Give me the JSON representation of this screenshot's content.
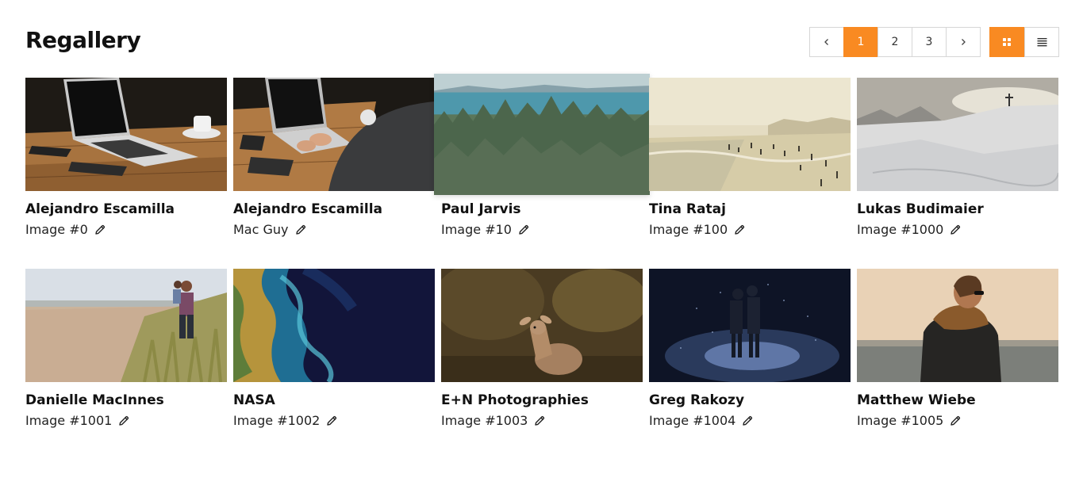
{
  "header": {
    "title": "Regallery"
  },
  "pagination": {
    "prev_icon": "chevron-left-icon",
    "next_icon": "chevron-right-icon",
    "pages": [
      "1",
      "2",
      "3"
    ],
    "current_page": "1"
  },
  "view_toggle": {
    "active": "grid",
    "grid_icon": "grid-icon",
    "list_icon": "list-icon"
  },
  "colors": {
    "accent": "#f98a22",
    "border": "#d6d6d6",
    "text": "#111111"
  },
  "gallery": {
    "items": [
      {
        "author": "Alejandro Escamilla",
        "caption": "Image #0",
        "photo": "laptop-on-wooden-table"
      },
      {
        "author": "Alejandro Escamilla",
        "caption": "Mac Guy",
        "photo": "person-typing-on-laptop"
      },
      {
        "author": "Paul Jarvis",
        "caption": "Image #10",
        "photo": "forest-and-sea"
      },
      {
        "author": "Tina Rataj",
        "caption": "Image #100",
        "photo": "beach-with-people"
      },
      {
        "author": "Lukas Budimaier",
        "caption": "Image #1000",
        "photo": "snowy-mountain-with-cross"
      },
      {
        "author": "Danielle MacInnes",
        "caption": "Image #1001",
        "photo": "man-carrying-child-on-beach"
      },
      {
        "author": "NASA",
        "caption": "Image #1002",
        "photo": "satellite-coastline"
      },
      {
        "author": "E+N Photographies",
        "caption": "Image #1003",
        "photo": "fawn-in-forest"
      },
      {
        "author": "Greg Rakozy",
        "caption": "Image #1004",
        "photo": "couple-in-night-rain"
      },
      {
        "author": "Matthew Wiebe",
        "caption": "Image #1005",
        "photo": "person-by-sea-at-sunset"
      }
    ]
  }
}
